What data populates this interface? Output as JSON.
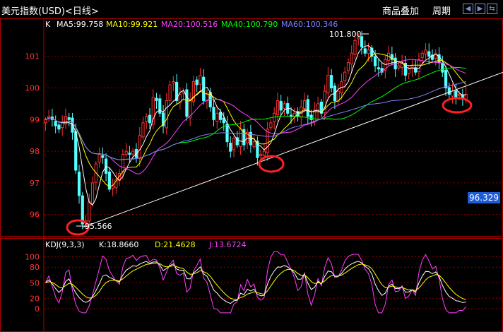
{
  "titlebar": {
    "title": "美元指数(USD)<日线>",
    "overlay_button": "商品叠加",
    "period_button": "周期",
    "icons": [
      "back-icon",
      "forward-icon",
      "swap-icon"
    ]
  },
  "price_panel": {
    "label": "K",
    "legend": [
      {
        "text": "MA5:99.758",
        "color": "#ffffff"
      },
      {
        "text": "MA10:99.921",
        "color": "#ffff00"
      },
      {
        "text": "MA20:100.516",
        "color": "#ff40ff"
      },
      {
        "text": "MA40:100.790",
        "color": "#00ff00"
      },
      {
        "text": "MA60:100.346",
        "color": "#8080ff"
      }
    ],
    "high_label": "101.800",
    "low_label": "95.566",
    "last_price": "96.329"
  },
  "kdj_panel": {
    "label": "KDJ(9,3,3)",
    "legend": [
      {
        "text": "K:18.8660",
        "color": "#ffffff"
      },
      {
        "text": "D:21.4628",
        "color": "#ffff00"
      },
      {
        "text": "J:13.6724",
        "color": "#ff40ff"
      }
    ]
  },
  "chart_data": [
    {
      "type": "candlestick",
      "title": "美元指数(USD)<日线>",
      "ylim": [
        95.3,
        102.2
      ],
      "y_ticks": [
        96,
        97,
        98,
        99,
        100,
        101
      ],
      "grid": true,
      "series": [
        {
          "name": "K",
          "close": [
            99.0,
            99.1,
            99.0,
            98.8,
            98.7,
            98.9,
            99.1,
            99.0,
            98.6,
            97.4,
            96.6,
            95.7,
            95.8,
            96.4,
            97.0,
            97.6,
            97.9,
            97.8,
            97.3,
            96.8,
            96.9,
            97.1,
            97.3,
            97.9,
            98.0,
            97.9,
            98.0,
            97.8,
            98.5,
            98.9,
            99.1,
            98.9,
            99.7,
            99.6,
            99.2,
            98.8,
            99.6,
            100.1,
            100.2,
            99.6,
            99.8,
            99.9,
            99.1,
            99.6,
            100.2,
            100.1,
            100.4,
            99.6,
            99.8,
            99.4,
            99.0,
            99.2,
            99.0,
            98.9,
            98.3,
            98.0,
            98.4,
            98.2,
            98.7,
            98.2,
            98.6,
            98.2,
            98.3,
            97.8,
            97.9,
            98.0,
            98.7,
            98.9,
            99.2,
            99.6,
            99.3,
            99.5,
            99.2,
            99.1,
            99.2,
            99.1,
            99.4,
            99.6,
            99.1,
            99.0,
            99.3,
            99.5,
            99.2,
            99.9,
            100.4,
            100.0,
            99.6,
            99.9,
            100.2,
            100.5,
            100.8,
            101.1,
            101.5,
            101.6,
            101.3,
            101.1,
            101.2,
            101.0,
            100.7,
            100.6,
            100.5,
            100.9,
            101.1,
            100.9,
            100.6,
            100.7,
            100.8,
            100.4,
            100.6,
            100.7,
            100.5,
            100.9,
            101.1,
            101.2,
            101.0,
            100.9,
            101.1,
            100.8,
            100.5,
            100.0,
            99.8,
            99.9,
            99.7,
            99.8,
            99.7,
            99.8
          ]
        },
        {
          "name": "MA5",
          "value_last": 99.758
        },
        {
          "name": "MA10",
          "value_last": 99.921
        },
        {
          "name": "MA20",
          "value_last": 100.516
        },
        {
          "name": "MA40",
          "value_last": 100.79
        },
        {
          "name": "MA60",
          "value_last": 100.346
        }
      ],
      "annotations": [
        "101.800",
        "95.566"
      ],
      "trendline": {
        "from": 95.6,
        "to": 100.0
      }
    },
    {
      "type": "line",
      "title": "KDJ(9,3,3)",
      "ylim": [
        0,
        100
      ],
      "y_ticks": [
        0,
        20,
        50,
        80,
        100
      ],
      "series": [
        {
          "name": "K",
          "value_last": 18.866
        },
        {
          "name": "D",
          "value_last": 21.4628
        },
        {
          "name": "J",
          "value_last": 13.6724
        }
      ]
    }
  ]
}
